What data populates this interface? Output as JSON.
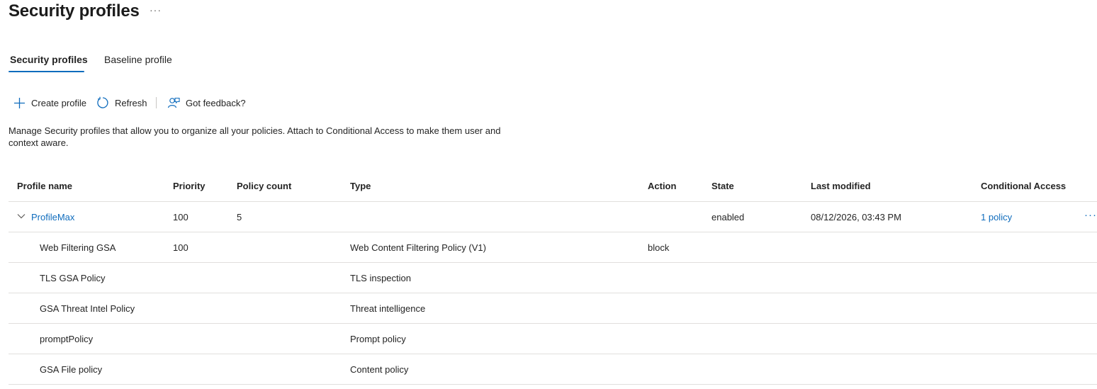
{
  "header": {
    "title": "Security profiles",
    "more": "···"
  },
  "tabs": [
    {
      "label": "Security profiles",
      "active": true
    },
    {
      "label": "Baseline profile",
      "active": false
    }
  ],
  "toolbar": {
    "create_label": "Create profile",
    "refresh_label": "Refresh",
    "feedback_label": "Got feedback?"
  },
  "description": "Manage Security profiles that allow you to organize all your policies. Attach to Conditional Access to make them user and context aware.",
  "table": {
    "columns": {
      "profile_name": "Profile name",
      "priority": "Priority",
      "policy_count": "Policy count",
      "type": "Type",
      "action": "Action",
      "state": "State",
      "last_modified": "Last modified",
      "conditional_access": "Conditional Access"
    },
    "profile": {
      "name": "ProfileMax",
      "priority": "100",
      "policy_count": "5",
      "state": "enabled",
      "last_modified": "08/12/2026, 03:43 PM",
      "conditional_access": "1 policy",
      "more": "···"
    },
    "policies": [
      {
        "name": "Web Filtering GSA",
        "priority": "100",
        "type": "Web Content Filtering Policy (V1)",
        "action": "block"
      },
      {
        "name": "TLS GSA Policy",
        "priority": "",
        "type": "TLS inspection",
        "action": ""
      },
      {
        "name": "GSA Threat Intel Policy",
        "priority": "",
        "type": "Threat intelligence",
        "action": ""
      },
      {
        "name": "promptPolicy",
        "priority": "",
        "type": "Prompt policy",
        "action": ""
      },
      {
        "name": "GSA File policy",
        "priority": "",
        "type": "Content policy",
        "action": ""
      }
    ]
  },
  "colors": {
    "accent": "#0f6cbd",
    "text": "#242424",
    "divider": "#e1dfdd"
  }
}
